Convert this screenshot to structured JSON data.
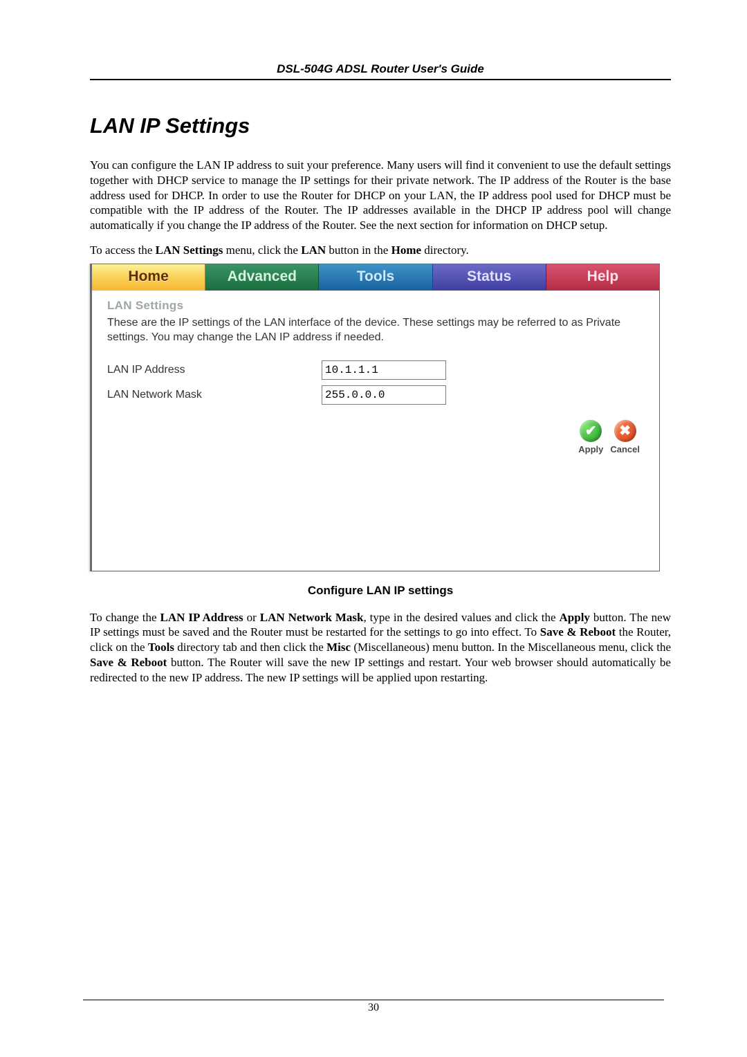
{
  "header": {
    "title": "DSL-504G ADSL Router User's Guide"
  },
  "heading": "LAN IP Settings",
  "para1": "You can configure the LAN IP address to suit your preference. Many users will find it convenient to use the default settings together with DHCP service to manage the IP settings for their private network. The IP address of the Router is the base address used for DHCP. In order to use the Router for DHCP on your LAN, the IP address pool used for DHCP must be compatible with the IP address of the Router. The IP addresses available in the DHCP IP address pool will change automatically if you change the IP address of the Router. See the next section for information on DHCP setup.",
  "para2_pre": "To access the ",
  "para2_b1": "LAN Settings",
  "para2_mid1": " menu, click the ",
  "para2_b2": "LAN",
  "para2_mid2": " button in the ",
  "para2_b3": "Home",
  "para2_end": " directory.",
  "ui": {
    "tabs": {
      "home": "Home",
      "advanced": "Advanced",
      "tools": "Tools",
      "status": "Status",
      "help": "Help"
    },
    "section_title": "LAN Settings",
    "desc": "These are the IP settings of the LAN interface of the device. These settings may be referred to as Private settings. You may change the LAN IP address if needed.",
    "ip_label": "LAN IP Address",
    "ip_value": "10.1.1.1",
    "mask_label": "LAN Network Mask",
    "mask_value": "255.0.0.0",
    "apply_label": "Apply",
    "cancel_label": "Cancel",
    "check_glyph": "✔",
    "x_glyph": "✖"
  },
  "caption": "Configure LAN IP settings",
  "para3_pre": "To change the ",
  "para3_b1": "LAN IP Address",
  "para3_mid1": " or ",
  "para3_b2": "LAN Network Mask",
  "para3_mid2": ", type in the desired values and click the ",
  "para3_b3": "Apply",
  "para3_mid3": " button. The new IP settings must be saved and the Router must be restarted for the settings to go into effect. To ",
  "para3_b4": "Save & Reboot",
  "para3_mid4": " the Router, click on the ",
  "para3_b5": "Tools",
  "para3_mid5": " directory tab and then click the ",
  "para3_b6": "Misc",
  "para3_mid6": " (Miscellaneous) menu button. In the Miscellaneous menu, click the ",
  "para3_b7": "Save & Reboot",
  "para3_end": " button. The Router will save the new IP settings and restart. Your web browser should automatically be redirected to the new IP address. The new IP settings will be applied upon restarting.",
  "page_number": "30"
}
